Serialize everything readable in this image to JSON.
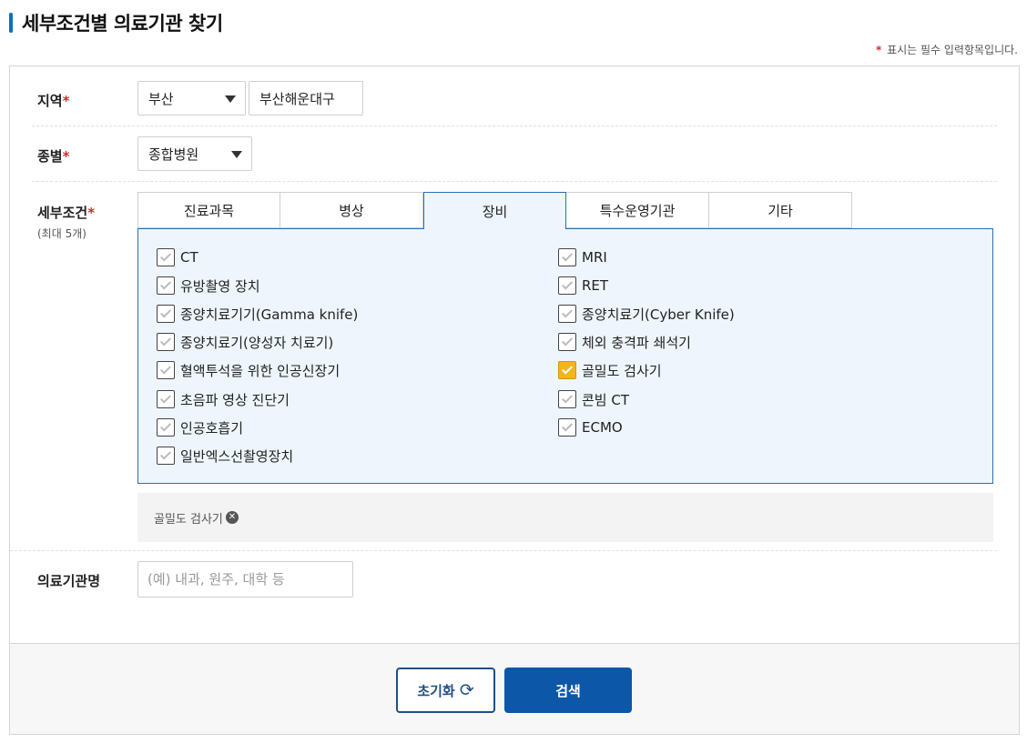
{
  "title": "세부조건별 의료기관 찾기",
  "required_note": {
    "star": "*",
    "text": "표시는 필수 입력항목입니다."
  },
  "region": {
    "label": "지역",
    "required_mark": "*",
    "city": "부산",
    "district": "부산해운대구"
  },
  "category": {
    "label": "종별",
    "required_mark": "*",
    "value": "종합병원"
  },
  "conditions": {
    "label": "세부조건",
    "required_mark": "*",
    "sub_label": "(최대 5개)",
    "tabs": [
      "진료과목",
      "병상",
      "장비",
      "특수운영기관",
      "기타"
    ],
    "active_tab": "장비",
    "left_items": [
      {
        "label": "CT",
        "checked": false
      },
      {
        "label": "유방촬영 장치",
        "checked": false
      },
      {
        "label": "종양치료기기(Gamma knife)",
        "checked": false
      },
      {
        "label": "종양치료기(양성자 치료기)",
        "checked": false
      },
      {
        "label": "혈액투석을 위한 인공신장기",
        "checked": false
      },
      {
        "label": "초음파 영상 진단기",
        "checked": false
      },
      {
        "label": "인공호흡기",
        "checked": false
      },
      {
        "label": "일반엑스선촬영장치",
        "checked": false
      }
    ],
    "right_items": [
      {
        "label": "MRI",
        "checked": false
      },
      {
        "label": "RET",
        "checked": false
      },
      {
        "label": "종양치료기(Cyber Knife)",
        "checked": false
      },
      {
        "label": "체외 충격파 쇄석기",
        "checked": false
      },
      {
        "label": "골밀도 검사기",
        "checked": true
      },
      {
        "label": "콘빔 CT",
        "checked": false
      },
      {
        "label": "ECMO",
        "checked": false
      }
    ],
    "selected_chips": [
      "골밀도 검사기"
    ]
  },
  "institution_name": {
    "label": "의료기관명",
    "placeholder": "(예) 내과, 원주, 대학 등"
  },
  "buttons": {
    "reset": "초기화",
    "search": "검색"
  },
  "colors": {
    "accent": "#0d57a8",
    "check": "#f5b41e",
    "required": "#d9272e",
    "panel_bg": "#eef5fc"
  }
}
